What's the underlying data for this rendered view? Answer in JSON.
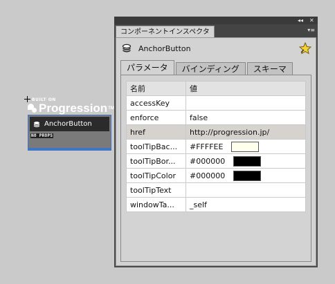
{
  "stage": {
    "logo_built_on": "BUILT ON",
    "logo_word": "Progression",
    "logo_tm": "TM",
    "component": {
      "label": "AnchorButton",
      "badge": "NO PROPS"
    }
  },
  "panel": {
    "title": "コンポーネントインスペクタ",
    "window_controls": [
      "◂◂",
      "✕"
    ],
    "menu_glyph": "▾≡",
    "component_name": "AnchorButton",
    "tabs": [
      {
        "label": "パラメータ",
        "active": true
      },
      {
        "label": "バインディング",
        "active": false
      },
      {
        "label": "スキーマ",
        "active": false
      }
    ],
    "table": {
      "headers": [
        "名前",
        "値"
      ],
      "rows": [
        {
          "key": "accessKey",
          "value": ""
        },
        {
          "key": "enforce",
          "value": "false"
        },
        {
          "key": "href",
          "value": "http://progression.jp/",
          "highlight": true
        },
        {
          "key": "toolTipBac...",
          "value": "#FFFFEE",
          "swatch": "#FFFFEE"
        },
        {
          "key": "toolTipBor...",
          "value": "#000000",
          "swatch": "#000000"
        },
        {
          "key": "toolTipColor",
          "value": "#000000",
          "swatch": "#000000"
        },
        {
          "key": "toolTipText",
          "value": ""
        },
        {
          "key": "windowTa...",
          "value": "_self"
        }
      ]
    }
  },
  "colors": {
    "background": "#cacaca",
    "selection": "#3e75c6",
    "panel_dark": "#4b4b4b",
    "panel_body": "#d3d3d3",
    "highlight_row": "#d6d3cf"
  }
}
